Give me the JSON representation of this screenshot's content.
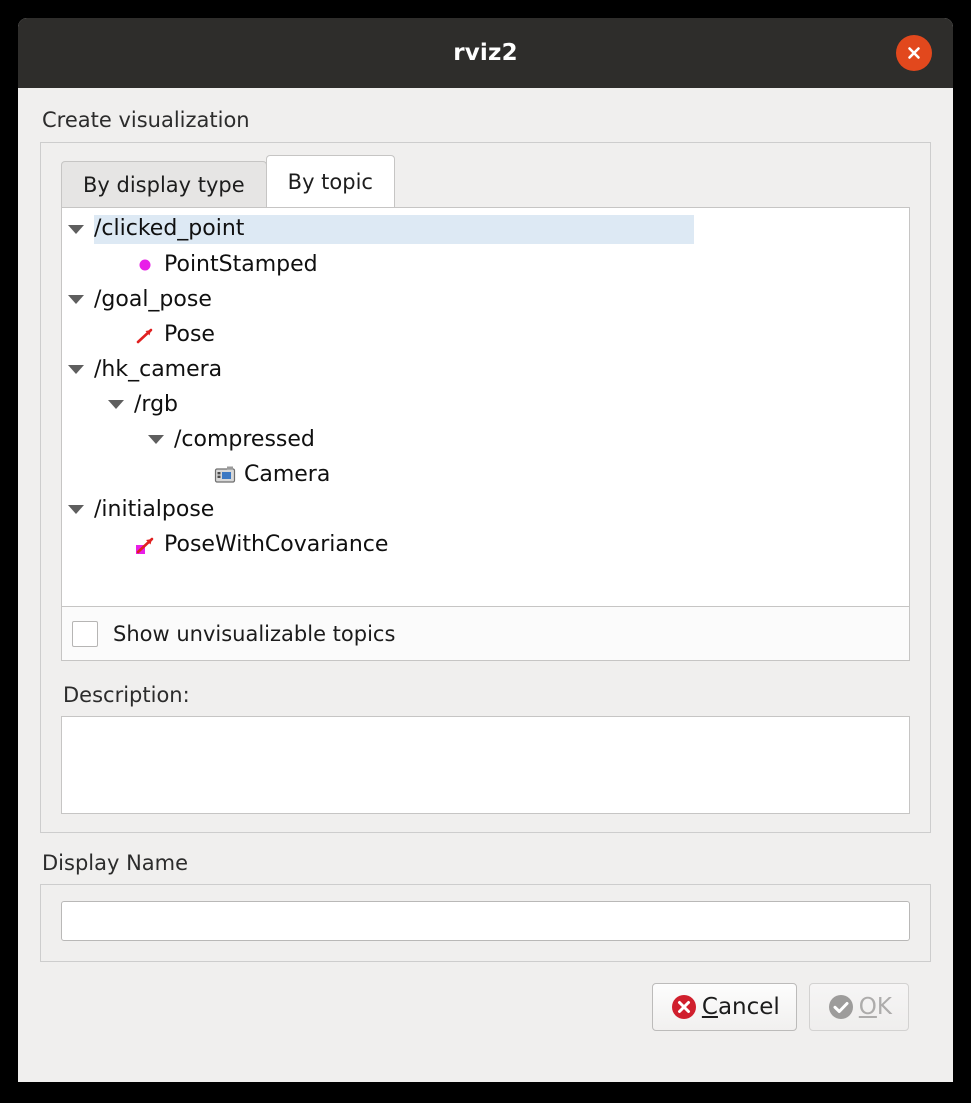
{
  "window": {
    "title": "rviz2",
    "close_icon": "close-icon",
    "accent_close": "#e2481d"
  },
  "dialog": {
    "heading": "Create visualization",
    "tabs": [
      {
        "label": "By display type",
        "active": false
      },
      {
        "label": "By topic",
        "active": true
      }
    ],
    "tree": [
      {
        "label": "/clicked_point",
        "depth": 0,
        "twisty": true,
        "selected": true,
        "icon": null
      },
      {
        "label": "PointStamped",
        "depth": 1,
        "twisty": false,
        "selected": false,
        "icon": "magenta-dot-icon"
      },
      {
        "label": "/goal_pose",
        "depth": 0,
        "twisty": true,
        "selected": false,
        "icon": null
      },
      {
        "label": "Pose",
        "depth": 1,
        "twisty": false,
        "selected": false,
        "icon": "red-arrow-icon"
      },
      {
        "label": "/hk_camera",
        "depth": 0,
        "twisty": true,
        "selected": false,
        "icon": null
      },
      {
        "label": "/rgb",
        "depth": 1,
        "twisty": true,
        "selected": false,
        "icon": null
      },
      {
        "label": "/compressed",
        "depth": 2,
        "twisty": true,
        "selected": false,
        "icon": null
      },
      {
        "label": "Camera",
        "depth": 3,
        "twisty": false,
        "selected": false,
        "icon": "camera-icon"
      },
      {
        "label": "/initialpose",
        "depth": 0,
        "twisty": true,
        "selected": false,
        "icon": null
      },
      {
        "label": "PoseWithCovariance",
        "depth": 1,
        "twisty": false,
        "selected": false,
        "icon": "pose-covariance-icon"
      }
    ],
    "show_unvisualizable": {
      "label": "Show unvisualizable topics",
      "checked": false
    },
    "description": {
      "label": "Description:",
      "value": ""
    },
    "display_name": {
      "label": "Display Name",
      "value": "",
      "placeholder": ""
    },
    "buttons": {
      "cancel": {
        "mnemonic": "C",
        "rest": "ancel",
        "icon": "cancel-error-icon",
        "enabled": true,
        "color": "#d01f2d"
      },
      "ok": {
        "mnemonic": "O",
        "rest": "K",
        "icon": "ok-check-icon",
        "enabled": false,
        "color": "#9d9c9b"
      }
    }
  },
  "colors": {
    "selection": "#dde9f4",
    "window_bg": "#f0efee",
    "titlebar_bg": "#2e2d2b",
    "magenta": "#e81ee8",
    "red_arrow": "#e02020"
  }
}
